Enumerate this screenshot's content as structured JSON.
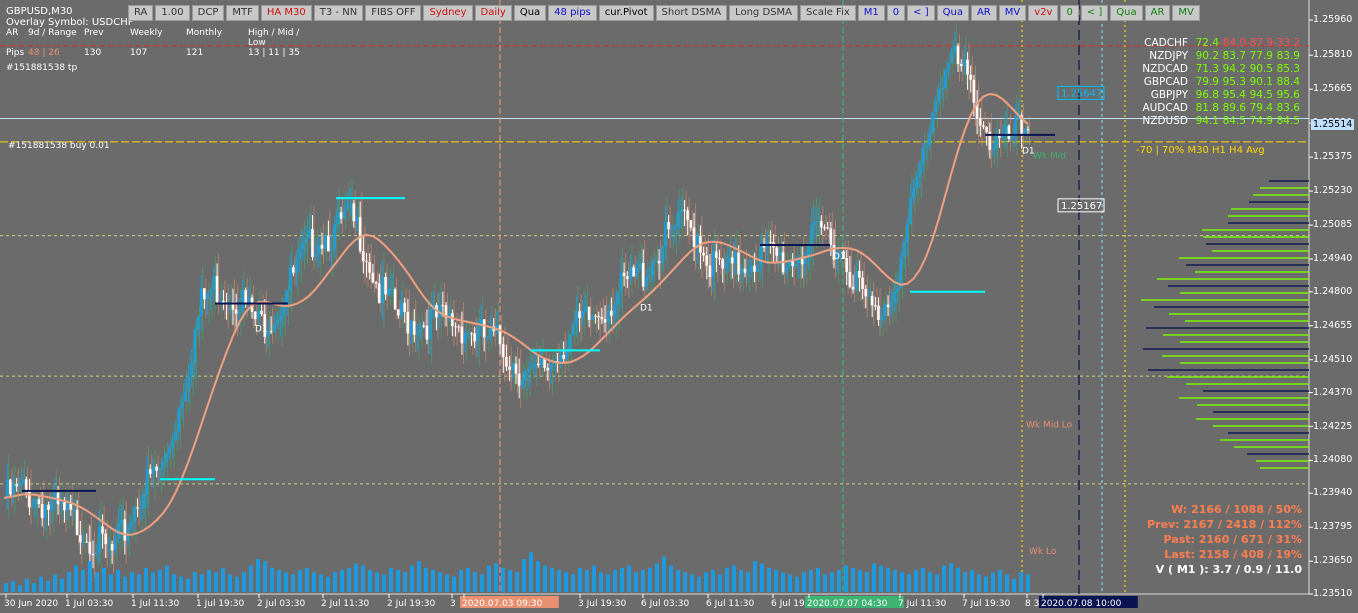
{
  "header": {
    "symbol_tf": "GBPUSD,M30",
    "overlay": "Overlay Symbol: USDCHF",
    "grid": {
      "labels": [
        "AR",
        "9d / Range",
        "Prev",
        "Weekly",
        "Monthly",
        "High / Mid / Low"
      ],
      "pips_label": "Pips",
      "range": "48 | 26",
      "prev": "130",
      "weekly": "107",
      "monthly": "121",
      "hml": "13 | 11 | 35"
    },
    "order_tp": "#151881538 tp",
    "order_buy": "#151881538 buy 0.01"
  },
  "toolbar": [
    {
      "label": "RA",
      "color": "#333333"
    },
    {
      "label": "1.00",
      "color": "#333333"
    },
    {
      "label": "DCP",
      "color": "#333333"
    },
    {
      "label": "MTF",
      "color": "#333333"
    },
    {
      "label": "HA M30",
      "color": "#d01010"
    },
    {
      "label": "T3 - NN",
      "color": "#333333"
    },
    {
      "label": "FIBS OFF",
      "color": "#333333"
    },
    {
      "label": "Sydney",
      "color": "#d01010"
    },
    {
      "label": "Daily",
      "color": "#d01010"
    },
    {
      "label": "Qua",
      "color": "#000000"
    },
    {
      "label": "48 pips",
      "color": "#1010d0"
    },
    {
      "label": "cur.Pivot",
      "color": "#000000"
    },
    {
      "label": "Short DSMA",
      "color": "#333333"
    },
    {
      "label": "Long DSMA",
      "color": "#333333"
    },
    {
      "label": "Scale Fix",
      "color": "#333333"
    },
    {
      "label": "M1",
      "color": "#1010d0"
    },
    {
      "label": "0",
      "color": "#1010d0"
    },
    {
      "label": "< ]",
      "color": "#1010d0"
    },
    {
      "label": "Qua",
      "color": "#1010d0"
    },
    {
      "label": "AR",
      "color": "#1010d0"
    },
    {
      "label": "MV",
      "color": "#1010d0"
    },
    {
      "label": "v2v",
      "color": "#d01010"
    },
    {
      "label": "0",
      "color": "#108010"
    },
    {
      "label": "< ]",
      "color": "#108010"
    },
    {
      "label": "Qua",
      "color": "#108010"
    },
    {
      "label": "AR",
      "color": "#108010"
    },
    {
      "label": "MV",
      "color": "#108010"
    }
  ],
  "pairs": [
    {
      "name": "CADCHF",
      "v": [
        "72.4",
        "-84.0",
        "-87.9",
        "-33.2"
      ]
    },
    {
      "name": "NZDJPY",
      "v": [
        "90.2",
        "83.7",
        "77.9",
        "83.9"
      ]
    },
    {
      "name": "NZDCAD",
      "v": [
        "71.3",
        "94.2",
        "90.5",
        "85.3"
      ]
    },
    {
      "name": "GBPCAD",
      "v": [
        "79.9",
        "95.3",
        "90.1",
        "88.4"
      ]
    },
    {
      "name": "GBPJPY",
      "v": [
        "96.8",
        "95.4",
        "94.5",
        "95.6"
      ]
    },
    {
      "name": "AUDCAD",
      "v": [
        "81.8",
        "89.6",
        "79.4",
        "83.6"
      ]
    },
    {
      "name": "NZDUSD",
      "v": [
        "94.1",
        "84.5",
        "74.9",
        "84.5"
      ]
    }
  ],
  "pair_footer": "-70 | 70%  M30  H1  H4  Avg",
  "stats": {
    "w": "W: 2166 / 1088 / 50%",
    "prev": "Prev: 2167 / 2418 / 112%",
    "past": "Past: 2160 / 671 / 31%",
    "last": "Last: 2158 / 408 / 19%",
    "v": "V ( M1 ): 3.7 / 0.9 / 11.0"
  },
  "colors": {
    "bg": "#6b6b6b",
    "bull": "#1e9be0",
    "bear": "#ffffff",
    "ha_up": "#3cb371",
    "ha_down": "#e89070",
    "navy": "#0a1450",
    "salmon": "#f0a080",
    "green_line": "#30c030",
    "volume": "#1e9be0",
    "stat_text": "#ff7f50"
  },
  "chart_data": {
    "type": "candlestick",
    "symbol": "GBPUSD",
    "timeframe": "M30",
    "price_axis": {
      "ticks": [
        1.2596,
        1.2581,
        1.25665,
        1.2552,
        1.25375,
        1.2523,
        1.25085,
        1.2494,
        1.248,
        1.24655,
        1.2451,
        1.2437,
        1.24225,
        1.2408,
        1.2394,
        1.23795,
        1.2365,
        1.2351
      ],
      "ylim": [
        1.2351,
        1.2602
      ]
    },
    "time_axis": {
      "ticks": [
        "30 Jun 2020",
        "1 Jul 03:30",
        "1 Jul 11:30",
        "1 Jul 19:30",
        "2 Jul 03:30",
        "2 Jul 11:30",
        "2 Jul 19:30",
        "3",
        "2020.07.03 09:30",
        "3 Jul 19:30",
        "6 Jul 03:30",
        "6 Jul 11:30",
        "6 Jul 19",
        "2020.07.07 04:30",
        "7 Jul 11:30",
        "7 Jul 19:30",
        "8 3",
        "2020.07.08 10:00"
      ]
    },
    "current_price": "1.25514",
    "price_markers": [
      "1.25647",
      "1.25167"
    ],
    "labels": {
      "wk_mid": "Wk Mid",
      "wk_mid_lo": "Wk Mid Lo",
      "wk_lo": "Wk Lo",
      "d1": "D1"
    },
    "close_path": [
      [
        0,
        1.2392
      ],
      [
        6,
        1.2395
      ],
      [
        12,
        1.239
      ],
      [
        18,
        1.2385
      ],
      [
        24,
        1.238
      ],
      [
        30,
        1.2372
      ],
      [
        34,
        1.2368
      ],
      [
        38,
        1.2378
      ],
      [
        42,
        1.2392
      ],
      [
        46,
        1.24
      ],
      [
        50,
        1.2405
      ],
      [
        54,
        1.2425
      ],
      [
        58,
        1.245
      ],
      [
        62,
        1.2475
      ],
      [
        66,
        1.2482
      ],
      [
        70,
        1.248
      ],
      [
        74,
        1.2478
      ],
      [
        80,
        1.2466
      ],
      [
        86,
        1.2472
      ],
      [
        92,
        1.249
      ],
      [
        98,
        1.2504
      ],
      [
        104,
        1.2505
      ],
      [
        108,
        1.2512
      ],
      [
        112,
        1.2505
      ],
      [
        118,
        1.248
      ],
      [
        124,
        1.247
      ],
      [
        130,
        1.2467
      ],
      [
        136,
        1.2468
      ],
      [
        142,
        1.2467
      ],
      [
        148,
        1.2462
      ],
      [
        152,
        1.246
      ],
      [
        156,
        1.2458
      ],
      [
        160,
        1.245
      ],
      [
        166,
        1.2442
      ],
      [
        172,
        1.245
      ],
      [
        178,
        1.2462
      ],
      [
        184,
        1.2468
      ],
      [
        190,
        1.2475
      ],
      [
        196,
        1.2483
      ],
      [
        202,
        1.249
      ],
      [
        208,
        1.2502
      ],
      [
        214,
        1.251
      ],
      [
        218,
        1.2505
      ],
      [
        222,
        1.2492
      ],
      [
        228,
        1.2488
      ],
      [
        234,
        1.2494
      ],
      [
        240,
        1.2496
      ],
      [
        246,
        1.2493
      ],
      [
        252,
        1.2498
      ],
      [
        258,
        1.2506
      ],
      [
        262,
        1.25
      ],
      [
        266,
        1.249
      ],
      [
        270,
        1.2478
      ],
      [
        274,
        1.247
      ],
      [
        278,
        1.2478
      ],
      [
        282,
        1.2492
      ],
      [
        286,
        1.252
      ],
      [
        290,
        1.2545
      ],
      [
        294,
        1.257
      ],
      [
        298,
        1.258
      ],
      [
        302,
        1.2572
      ],
      [
        306,
        1.256
      ],
      [
        310,
        1.2545
      ],
      [
        314,
        1.2542
      ],
      [
        318,
        1.2547
      ],
      [
        322,
        1.2551
      ]
    ],
    "volume": [
      4,
      5,
      3,
      6,
      4,
      7,
      5,
      8,
      6,
      9,
      12,
      10,
      14,
      9,
      11,
      8,
      10,
      7,
      9,
      8,
      11,
      9,
      10,
      12,
      8,
      7,
      6,
      9,
      8,
      10,
      9,
      11,
      8,
      7,
      9,
      12,
      15,
      14,
      11,
      10,
      9,
      8,
      10,
      11,
      9,
      8,
      7,
      9,
      10,
      11,
      13,
      12,
      10,
      9,
      8,
      11,
      10,
      9,
      12,
      14,
      11,
      10,
      9,
      8,
      7,
      10,
      11,
      9,
      8,
      12,
      13,
      11,
      10,
      9,
      15,
      18,
      14,
      12,
      11,
      10,
      9,
      8,
      11,
      10,
      12,
      9,
      8,
      10,
      11,
      12,
      9,
      10,
      11,
      13,
      16,
      12,
      10,
      9,
      8,
      7,
      9,
      10,
      8,
      11,
      12,
      10,
      9,
      14,
      13,
      11,
      10,
      9,
      8,
      7,
      9,
      10,
      11,
      8,
      9,
      10,
      12,
      11,
      10,
      9,
      13,
      12,
      11,
      10,
      9,
      8,
      10,
      11,
      9,
      8,
      12,
      13,
      11,
      9,
      10,
      8,
      7,
      9,
      10,
      8,
      6,
      9,
      8,
      7
    ]
  }
}
